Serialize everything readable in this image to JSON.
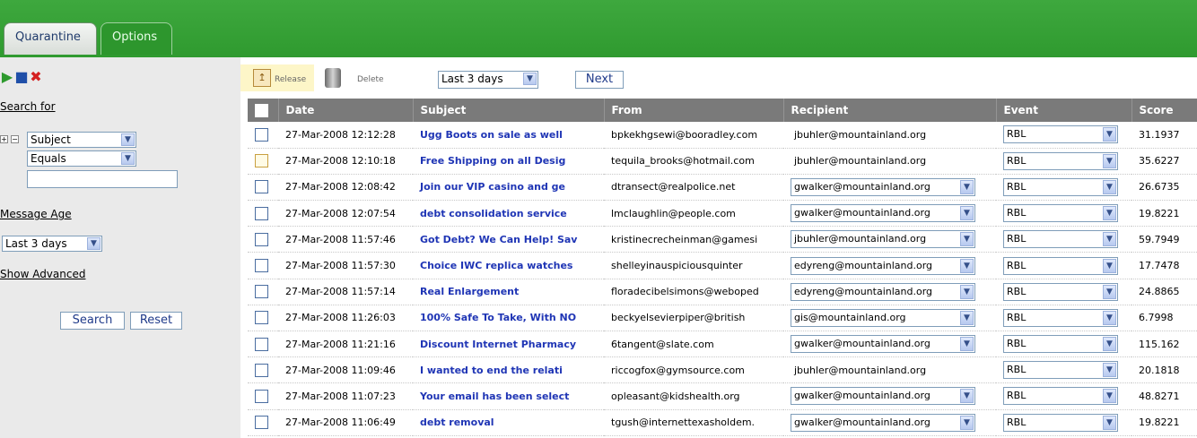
{
  "tabs": [
    "Quarantine",
    "Options"
  ],
  "sidebar": {
    "search_for": "Search for",
    "field_select": "Subject",
    "operator_select": "Equals",
    "message_age_label": "Message Age",
    "age_select": "Last 3 days",
    "show_advanced": "Show Advanced",
    "search_button": "Search",
    "reset_button": "Reset"
  },
  "toolbar": {
    "release": "Release",
    "delete": "Delete",
    "range_select": "Last 3 days",
    "next": "Next"
  },
  "table": {
    "headers": [
      "Date",
      "Subject",
      "From",
      "Recipient",
      "Event",
      "Score"
    ],
    "rows": [
      {
        "date": "27-Mar-2008 12:12:28",
        "subject": "Ugg Boots on sale as well",
        "from": "bpkekhgsewi@booradley.com",
        "recipient": "jbuhler@mountainland.org",
        "recipient_select": false,
        "event": "RBL",
        "score": "31.1937",
        "highlight": false
      },
      {
        "date": "27-Mar-2008 12:10:18",
        "subject": "Free Shipping on all Desig",
        "from": "tequila_brooks@hotmail.com",
        "recipient": "jbuhler@mountainland.org",
        "recipient_select": false,
        "event": "RBL",
        "score": "35.6227",
        "highlight": true
      },
      {
        "date": "27-Mar-2008 12:08:42",
        "subject": "Join our VIP casino and ge",
        "from": "dtransect@realpolice.net",
        "recipient": "gwalker@mountainland.org",
        "recipient_select": true,
        "event": "RBL",
        "score": "26.6735",
        "highlight": false
      },
      {
        "date": "27-Mar-2008 12:07:54",
        "subject": "debt consolidation service",
        "from": "lmclaughlin@people.com",
        "recipient": "gwalker@mountainland.org",
        "recipient_select": true,
        "event": "RBL",
        "score": "19.8221",
        "highlight": false
      },
      {
        "date": "27-Mar-2008 11:57:46",
        "subject": "Got Debt? We Can Help! Sav",
        "from": "kristinecrecheinman@gamesi",
        "recipient": "jbuhler@mountainland.org",
        "recipient_select": true,
        "event": "RBL",
        "score": "59.7949",
        "highlight": false
      },
      {
        "date": "27-Mar-2008 11:57:30",
        "subject": "Choice IWC replica watches",
        "from": "shelleyinauspiciousquinter",
        "recipient": "edyreng@mountainland.org",
        "recipient_select": true,
        "event": "RBL",
        "score": "17.7478",
        "highlight": false
      },
      {
        "date": "27-Mar-2008 11:57:14",
        "subject": "Real Enlargement",
        "from": "floradecibelsimons@weboped",
        "recipient": "edyreng@mountainland.org",
        "recipient_select": true,
        "event": "RBL",
        "score": "24.8865",
        "highlight": false
      },
      {
        "date": "27-Mar-2008 11:26:03",
        "subject": "100% Safe To Take, With NO",
        "from": "beckyelsevierpiper@british",
        "recipient": "gis@mountainland.org",
        "recipient_select": true,
        "event": "RBL",
        "score": "6.7998",
        "highlight": false
      },
      {
        "date": "27-Mar-2008 11:21:16",
        "subject": "Discount Internet Pharmacy",
        "from": "6tangent@slate.com",
        "recipient": "gwalker@mountainland.org",
        "recipient_select": true,
        "event": "RBL",
        "score": "115.162",
        "highlight": false
      },
      {
        "date": "27-Mar-2008 11:09:46",
        "subject": "I wanted to end the relati",
        "from": "riccogfox@gymsource.com",
        "recipient": "jbuhler@mountainland.org",
        "recipient_select": false,
        "event": "RBL",
        "score": "20.1818",
        "highlight": false
      },
      {
        "date": "27-Mar-2008 11:07:23",
        "subject": "Your email has been select",
        "from": "opleasant@kidshealth.org",
        "recipient": "gwalker@mountainland.org",
        "recipient_select": true,
        "event": "RBL",
        "score": "48.8271",
        "highlight": false
      },
      {
        "date": "27-Mar-2008 11:06:49",
        "subject": "debt removal",
        "from": "tgush@internettexasholdem.",
        "recipient": "gwalker@mountainland.org",
        "recipient_select": true,
        "event": "RBL",
        "score": "19.8221",
        "highlight": false
      }
    ]
  }
}
